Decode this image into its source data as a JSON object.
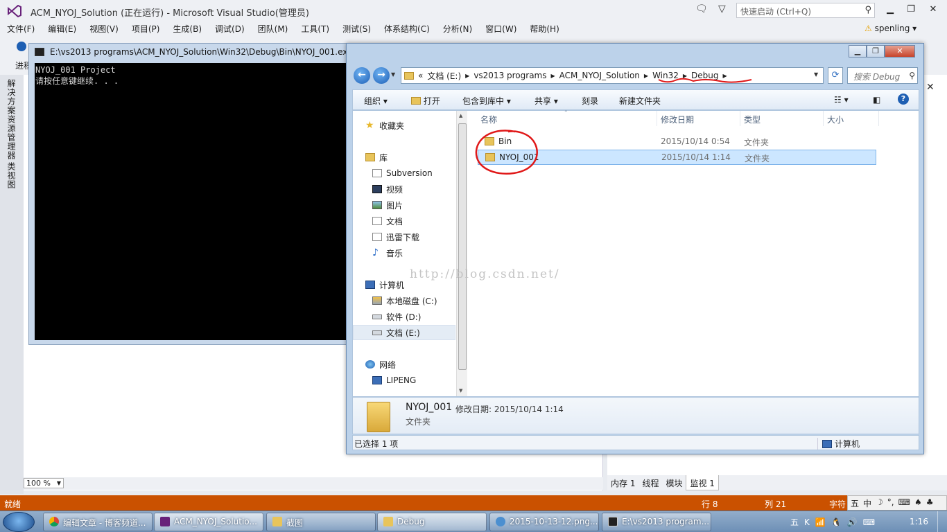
{
  "vs": {
    "title": "ACM_NYOJ_Solution (正在运行) - Microsoft Visual Studio(管理员)",
    "quick_launch_placeholder": "快速启动 (Ctrl+Q)",
    "menu": [
      "文件(F)",
      "编辑(E)",
      "视图(V)",
      "项目(P)",
      "生成(B)",
      "调试(D)",
      "团队(M)",
      "工具(T)",
      "测试(S)",
      "体系结构(C)",
      "分析(N)",
      "窗口(W)",
      "帮助(H)"
    ],
    "user": "spenling",
    "toolbar_fragment": "进程",
    "left_tabs": [
      "解决方案资源管理器",
      "类视图"
    ],
    "zoom": "100 %",
    "debug_tabs": [
      "内存 1",
      "线程",
      "模块",
      "监视 1"
    ],
    "status": {
      "ready": "就绪",
      "row": "行 8",
      "col": "列 21",
      "ch": "字符"
    },
    "ime": [
      "五",
      "中",
      "☽",
      "°,",
      "⌨",
      "♠",
      "♣"
    ]
  },
  "console": {
    "title": "E:\\vs2013 programs\\ACM_NYOJ_Solution\\Win32\\Debug\\Bin\\NYOJ_001.exe",
    "lines": [
      "NYOJ_001 Project",
      "请按任意键继续. . ."
    ]
  },
  "explorer": {
    "breadcrumb": [
      "«",
      "文档 (E:)",
      "vs2013 programs",
      "ACM_NYOJ_Solution",
      "Win32",
      "Debug"
    ],
    "search_placeholder": "搜索 Debug",
    "toolbar": {
      "organize": "组织",
      "open": "打开",
      "include": "包含到库中",
      "share": "共享",
      "burn": "刻录",
      "newfolder": "新建文件夹"
    },
    "nav": {
      "favorites": "收藏夹",
      "libraries": "库",
      "lib_items": [
        "Subversion",
        "视频",
        "图片",
        "文档",
        "迅雷下载",
        "音乐"
      ],
      "computer": "计算机",
      "drives": [
        "本地磁盘 (C:)",
        "软件 (D:)",
        "文档 (E:)"
      ],
      "network": "网络",
      "net_items": [
        "LIPENG"
      ]
    },
    "columns": {
      "name": "名称",
      "date": "修改日期",
      "type": "类型",
      "size": "大小"
    },
    "files": [
      {
        "name": "Bin",
        "date": "2015/10/14 0:54",
        "type": "文件夹"
      },
      {
        "name": "NYOJ_001",
        "date": "2015/10/14 1:14",
        "type": "文件夹"
      }
    ],
    "watermark": "http://blog.csdn.net/",
    "details": {
      "name": "NYOJ_001",
      "date": "修改日期: 2015/10/14 1:14",
      "type": "文件夹"
    },
    "status": {
      "selected": "已选择 1 项",
      "location": "计算机"
    }
  },
  "taskbar": {
    "tasks": [
      "编辑文章 - 博客频道...",
      "ACM_NYOJ_Solutio...",
      "截图",
      "Debug",
      "2015-10-13-12.png...",
      "E:\\vs2013 program..."
    ],
    "tray": [
      "五",
      "K",
      "📶",
      "🐧",
      "🔊",
      "⌨"
    ],
    "clock": "1:16"
  },
  "colors": {
    "vs_status": "#ca5100",
    "annotation": "#e01818",
    "selection": "#cce6ff"
  }
}
